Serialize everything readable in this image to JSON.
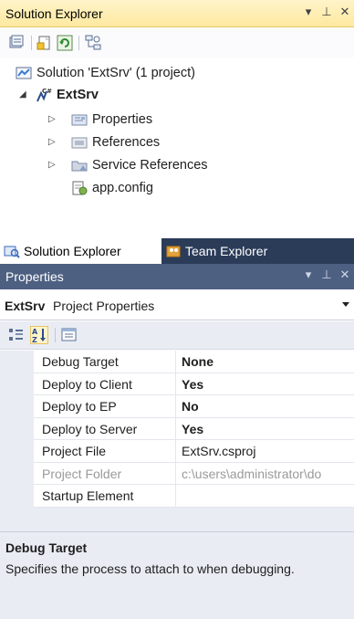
{
  "solution_explorer": {
    "title": "Solution Explorer",
    "controls": {
      "dropdown": "▾",
      "pin": "⊥",
      "close": "✕"
    },
    "tree": {
      "solution": "Solution 'ExtSrv' (1 project)",
      "project": "ExtSrv",
      "items": [
        "Properties",
        "References",
        "Service References",
        "app.config"
      ]
    },
    "tabs": [
      "Solution Explorer",
      "Team Explorer"
    ]
  },
  "properties": {
    "title": "Properties",
    "controls": {
      "dropdown": "▾",
      "pin": "⊥",
      "close": "✕"
    },
    "object_name": "ExtSrv",
    "object_type": "Project Properties",
    "rows": [
      {
        "name": "Debug Target",
        "value": "None"
      },
      {
        "name": "Deploy to Client",
        "value": "Yes"
      },
      {
        "name": "Deploy to EP",
        "value": "No"
      },
      {
        "name": "Deploy to Server",
        "value": "Yes"
      },
      {
        "name": "Project File",
        "value": "ExtSrv.csproj"
      },
      {
        "name": "Project Folder",
        "value": "c:\\users\\administrator\\do"
      },
      {
        "name": "Startup Element",
        "value": ""
      }
    ],
    "description": {
      "title": "Debug Target",
      "text": "Specifies the process to attach to when debugging."
    }
  },
  "colors": {
    "active_title": "#ffe9a0",
    "inactive_title": "#4d6082",
    "tab_inactive": "#2b3c59",
    "panel_bg": "#e9ecf3"
  }
}
